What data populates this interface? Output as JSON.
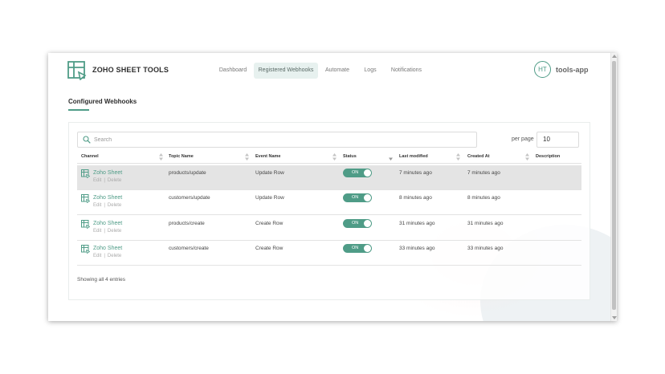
{
  "header": {
    "brand": "ZOHO SHEET TOOLS",
    "nav": [
      {
        "label": "Dashboard",
        "active": false
      },
      {
        "label": "Registered Webhooks",
        "active": true
      },
      {
        "label": "Automate",
        "active": false
      },
      {
        "label": "Logs",
        "active": false
      },
      {
        "label": "Notifications",
        "active": false
      }
    ],
    "avatar_initials": "HT",
    "app_name": "tools-app"
  },
  "section": {
    "title": "Configured Webhooks"
  },
  "search": {
    "placeholder": "Search",
    "value": ""
  },
  "per_page": {
    "label": "per page",
    "value": "10"
  },
  "table": {
    "columns": [
      "Channel",
      "Topic Name",
      "Event Name",
      "Status",
      "Last modified",
      "Created At",
      "Description"
    ],
    "rows": [
      {
        "channel": "Zoho Sheet",
        "edit": "Edit",
        "delete": "Delete",
        "topic": "products/update",
        "event": "Update Row",
        "status": "ON",
        "modified": "7 minutes ago",
        "created": "7 minutes ago",
        "description": ""
      },
      {
        "channel": "Zoho Sheet",
        "edit": "Edit",
        "delete": "Delete",
        "topic": "customers/update",
        "event": "Update Row",
        "status": "ON",
        "modified": "8 minutes ago",
        "created": "8 minutes ago",
        "description": ""
      },
      {
        "channel": "Zoho Sheet",
        "edit": "Edit",
        "delete": "Delete",
        "topic": "products/create",
        "event": "Create Row",
        "status": "ON",
        "modified": "31 minutes ago",
        "created": "31 minutes ago",
        "description": ""
      },
      {
        "channel": "Zoho Sheet",
        "edit": "Edit",
        "delete": "Delete",
        "topic": "customers/create",
        "event": "Create Row",
        "status": "ON",
        "modified": "33 minutes ago",
        "created": "33 minutes ago",
        "description": ""
      }
    ]
  },
  "footer": {
    "entries_text": "Showing all 4 entries"
  },
  "colors": {
    "accent": "#4f9c87",
    "highlight_row": "#e4e4e4"
  }
}
